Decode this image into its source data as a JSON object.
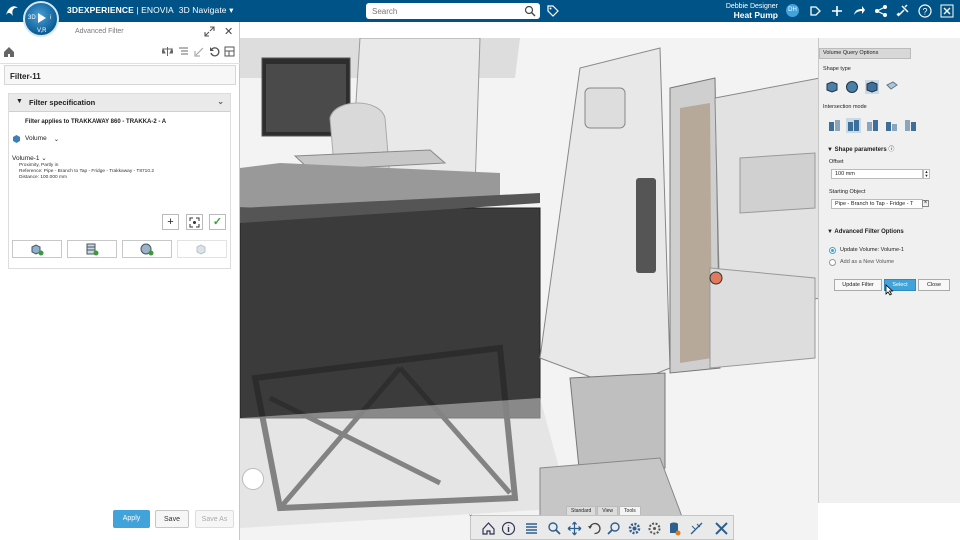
{
  "topbar": {
    "brand_bold": "3DEXPERIENCE",
    "brand_rest": " | ENOVIA",
    "app_name": "3D Navigate",
    "search_placeholder": "Search",
    "user_name": "Debbie Designer",
    "context": "Heat Pump",
    "avatar_initials": "DH",
    "compass_version": "V,R"
  },
  "left_panel": {
    "title": "Advanced Filter",
    "filter_name": "Filter-11",
    "spec_header": "Filter specification",
    "applies_to": "Filter applies to TRAKKAWAY 860 - TRAKKA-2 - A",
    "volume_type": "Volume",
    "volume_name": "Volume-1",
    "details": [
      "Proximity, Partly in",
      "Reference: Pipe - Branch to Tap - Fridge - Trakkaway - T8710.2",
      "Distance: 100.000 mm"
    ],
    "footer": {
      "apply": "Apply",
      "save": "Save",
      "save_as": "Save As"
    }
  },
  "right_panel": {
    "tab": "Volume Query Options",
    "shape_type_label": "Shape type",
    "intersection_label": "Intersection mode",
    "shape_params_header": "Shape parameters",
    "offset_label": "Offset",
    "offset_value": "100 mm",
    "starting_object_label": "Starting Object",
    "starting_object_value": "Pipe - Branch to Tap - Fridge - T",
    "advanced_header": "Advanced Filter Options",
    "option_update": "Update Volume: Volume-1",
    "option_add": "Add as a New Volume",
    "selected_option": "Update Volume: Volume-1",
    "btn_update": "Update Filter",
    "btn_select": "Select",
    "btn_close": "Close"
  },
  "bottom_toolbar": {
    "tabs": [
      "Standard",
      "View",
      "Tools"
    ],
    "active_tab": "Tools"
  },
  "colors": {
    "topbar": "#005386",
    "accent": "#42a2da",
    "apply_button": "#42a2da"
  }
}
